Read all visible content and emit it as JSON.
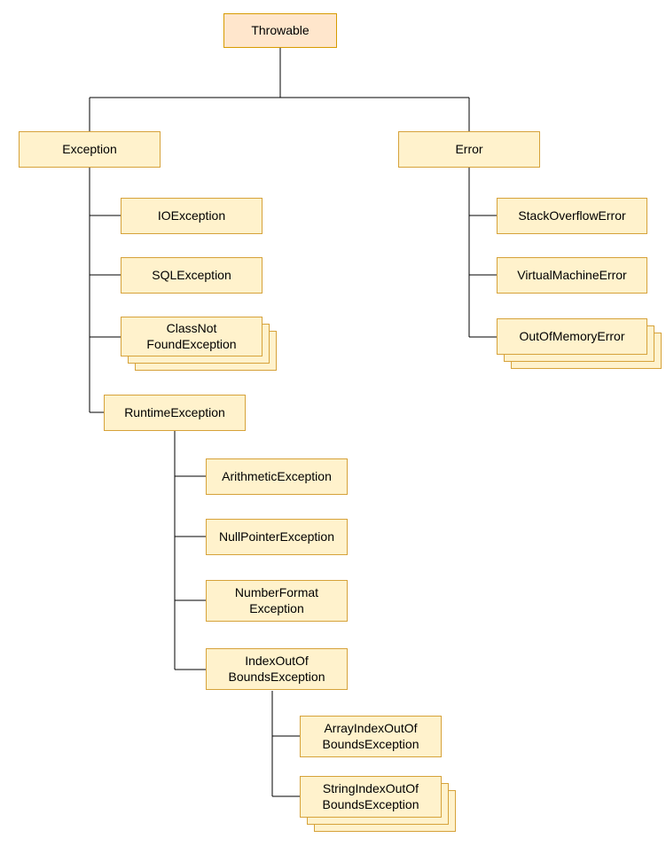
{
  "diagram": {
    "type": "class-hierarchy",
    "root": "Throwable",
    "nodes": {
      "throwable": "Throwable",
      "exception": "Exception",
      "error": "Error",
      "ioexception": "IOException",
      "sqlexception": "SQLException",
      "classnotfound_l1": "ClassNot",
      "classnotfound_l2": "FoundException",
      "runtimeexception": "RuntimeException",
      "arithmetic": "ArithmeticException",
      "nullpointer": "NullPointerException",
      "numberformat_l1": "NumberFormat",
      "numberformat_l2": "Exception",
      "indexoutof_l1": "IndexOutOf",
      "indexoutof_l2": "BoundsException",
      "arrayindex_l1": "ArrayIndexOutOf",
      "arrayindex_l2": "BoundsException",
      "stringindex_l1": "StringIndexOutOf",
      "stringindex_l2": "BoundsException",
      "stackoverflow": "StackOverflowError",
      "virtualmachine": "VirtualMachineError",
      "outofmemory": "OutOfMemoryError"
    }
  }
}
